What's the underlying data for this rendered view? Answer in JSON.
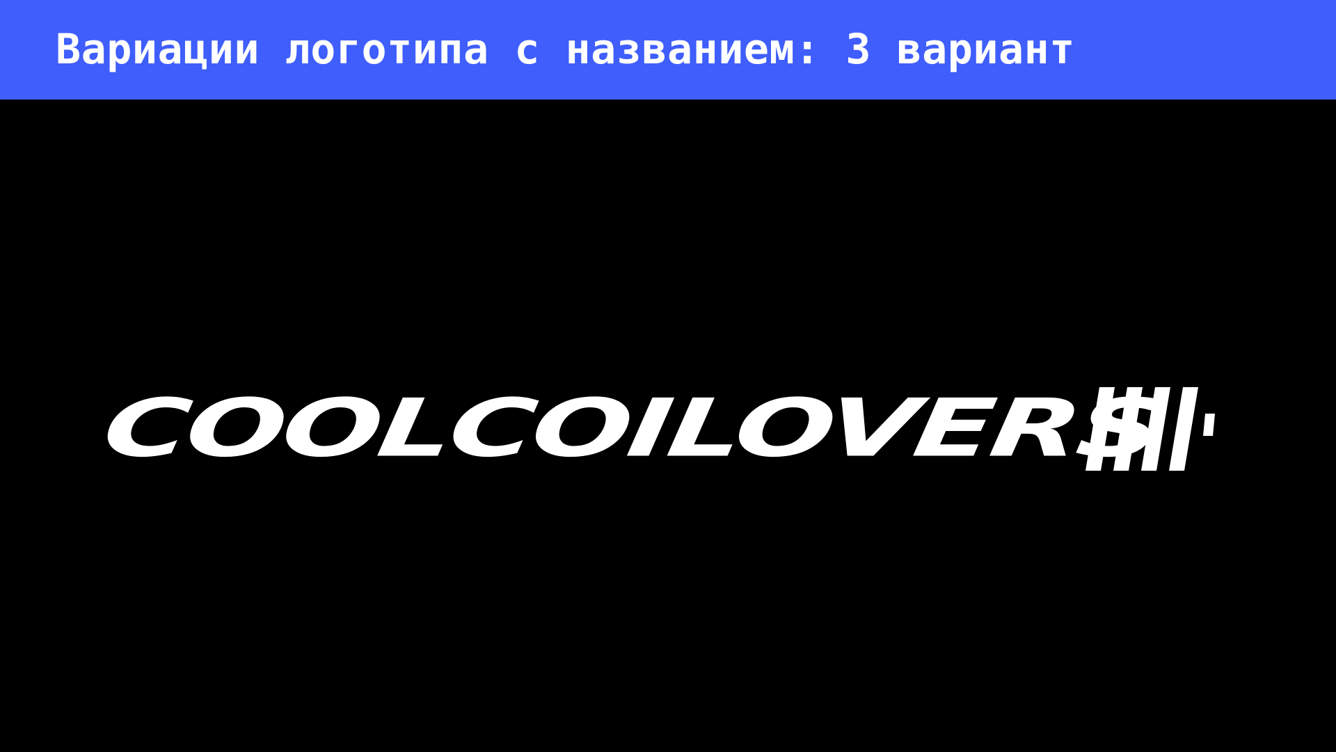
{
  "header": {
    "title": "Вариации логотипа с названием: 3 вариант",
    "background_color": "#3f5efb",
    "text_color": "#ffffff"
  },
  "stage": {
    "background_color": "#000000"
  },
  "logo": {
    "wordmark": "COOLCOILOVERS",
    "color": "#ffffff",
    "mark_icon": "coilover-stripes-icon"
  }
}
